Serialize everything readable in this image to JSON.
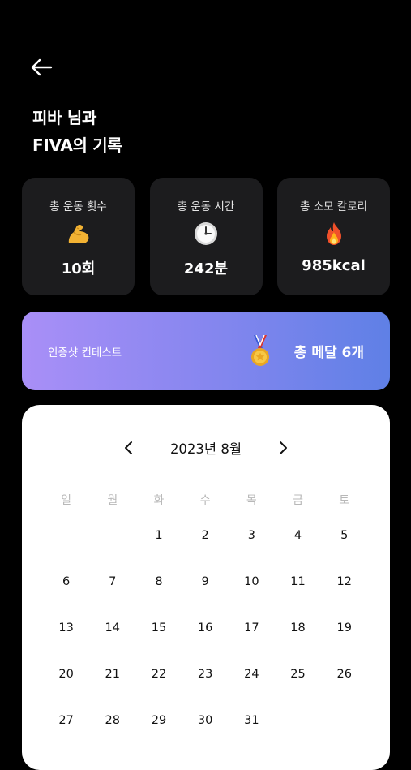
{
  "header": {
    "back_icon": "arrow-left-icon",
    "title_line1": "피바 님과",
    "title_line2": "FIVA의 기록"
  },
  "stats": [
    {
      "label": "총 운동 횟수",
      "icon": "flexed-biceps-icon",
      "value": "10회"
    },
    {
      "label": "총 운동 시간",
      "icon": "clock-icon",
      "value": "242분"
    },
    {
      "label": "총 소모 칼로리",
      "icon": "fire-icon",
      "value": "985kcal"
    }
  ],
  "banner": {
    "label": "인증샷 컨테스트",
    "icon": "medal-icon",
    "medals": "총 메달 6개",
    "gradient": [
      "#a98ff7",
      "#5f80e6"
    ]
  },
  "calendar": {
    "title": "2023년 8월",
    "weekdays": [
      "일",
      "월",
      "화",
      "수",
      "목",
      "금",
      "토"
    ],
    "leading_blanks": 2,
    "days": [
      "1",
      "2",
      "3",
      "4",
      "5",
      "6",
      "7",
      "8",
      "9",
      "10",
      "11",
      "12",
      "13",
      "14",
      "15",
      "16",
      "17",
      "18",
      "19",
      "20",
      "21",
      "22",
      "23",
      "24",
      "25",
      "26",
      "27",
      "28",
      "29",
      "30",
      "31"
    ]
  }
}
